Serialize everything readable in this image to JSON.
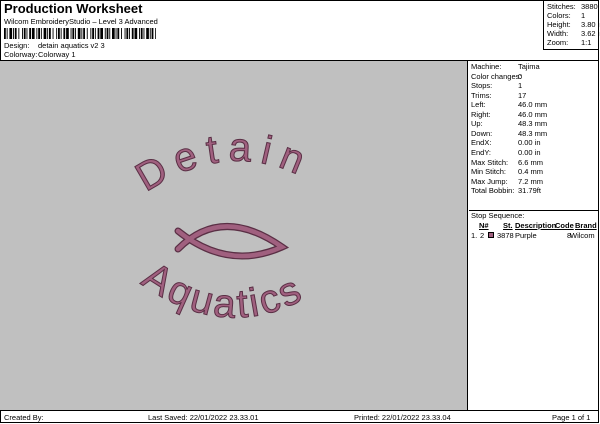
{
  "header": {
    "title": "Production Worksheet",
    "subtitle": "Wilcom EmbroideryStudio – Level 3 Advanced",
    "design_label": "Design:",
    "design_value": "detain aquatics v2 3",
    "colorway_label": "Colorway:",
    "colorway_value": "Colorway 1"
  },
  "stats": [
    {
      "label": "Stitches:",
      "value": "3880"
    },
    {
      "label": "Colors:",
      "value": "1"
    },
    {
      "label": "Height:",
      "value": "3.80 in"
    },
    {
      "label": "Width:",
      "value": "3.62 in"
    },
    {
      "label": "Zoom:",
      "value": "1:1"
    }
  ],
  "design": {
    "line1": "Detain",
    "line2": "Aquatics",
    "thread_color": "#a0607f",
    "background_color": "#c0c0c0"
  },
  "machine": [
    {
      "label": "Machine:",
      "value": "Tajima"
    },
    {
      "label": "Color changes:",
      "value": "0"
    },
    {
      "label": "Stops:",
      "value": "1"
    },
    {
      "label": "Trims:",
      "value": "17"
    },
    {
      "label": "Left:",
      "value": "46.0 mm"
    },
    {
      "label": "Right:",
      "value": "46.0 mm"
    },
    {
      "label": "Up:",
      "value": "48.3 mm"
    },
    {
      "label": "Down:",
      "value": "48.3 mm"
    },
    {
      "label": "EndX:",
      "value": "0.00 in"
    },
    {
      "label": "EndY:",
      "value": "0.00 in"
    },
    {
      "label": "Max Stitch:",
      "value": "6.6 mm"
    },
    {
      "label": "Min Stitch:",
      "value": "0.4 mm"
    },
    {
      "label": "Max Jump:",
      "value": "7.2 mm"
    },
    {
      "label": "Total Bobbin:",
      "value": "31.79ft"
    }
  ],
  "stop_sequence": {
    "title": "Stop Sequence:",
    "headers": {
      "n": "N#",
      "st": "St.",
      "description": "Description",
      "code": "Code",
      "brand": "Brand"
    },
    "rows": [
      {
        "index": "1.",
        "n": "2",
        "st": "3878",
        "description": "Purple",
        "code": "8",
        "brand": "Wilcom",
        "color": "#a0607f"
      }
    ]
  },
  "footer": {
    "created_by": "Created By:",
    "last_saved": "Last Saved: 22/01/2022 23.33.01",
    "printed": "Printed: 22/01/2022 23.33.04",
    "page": "Page 1 of 1"
  }
}
